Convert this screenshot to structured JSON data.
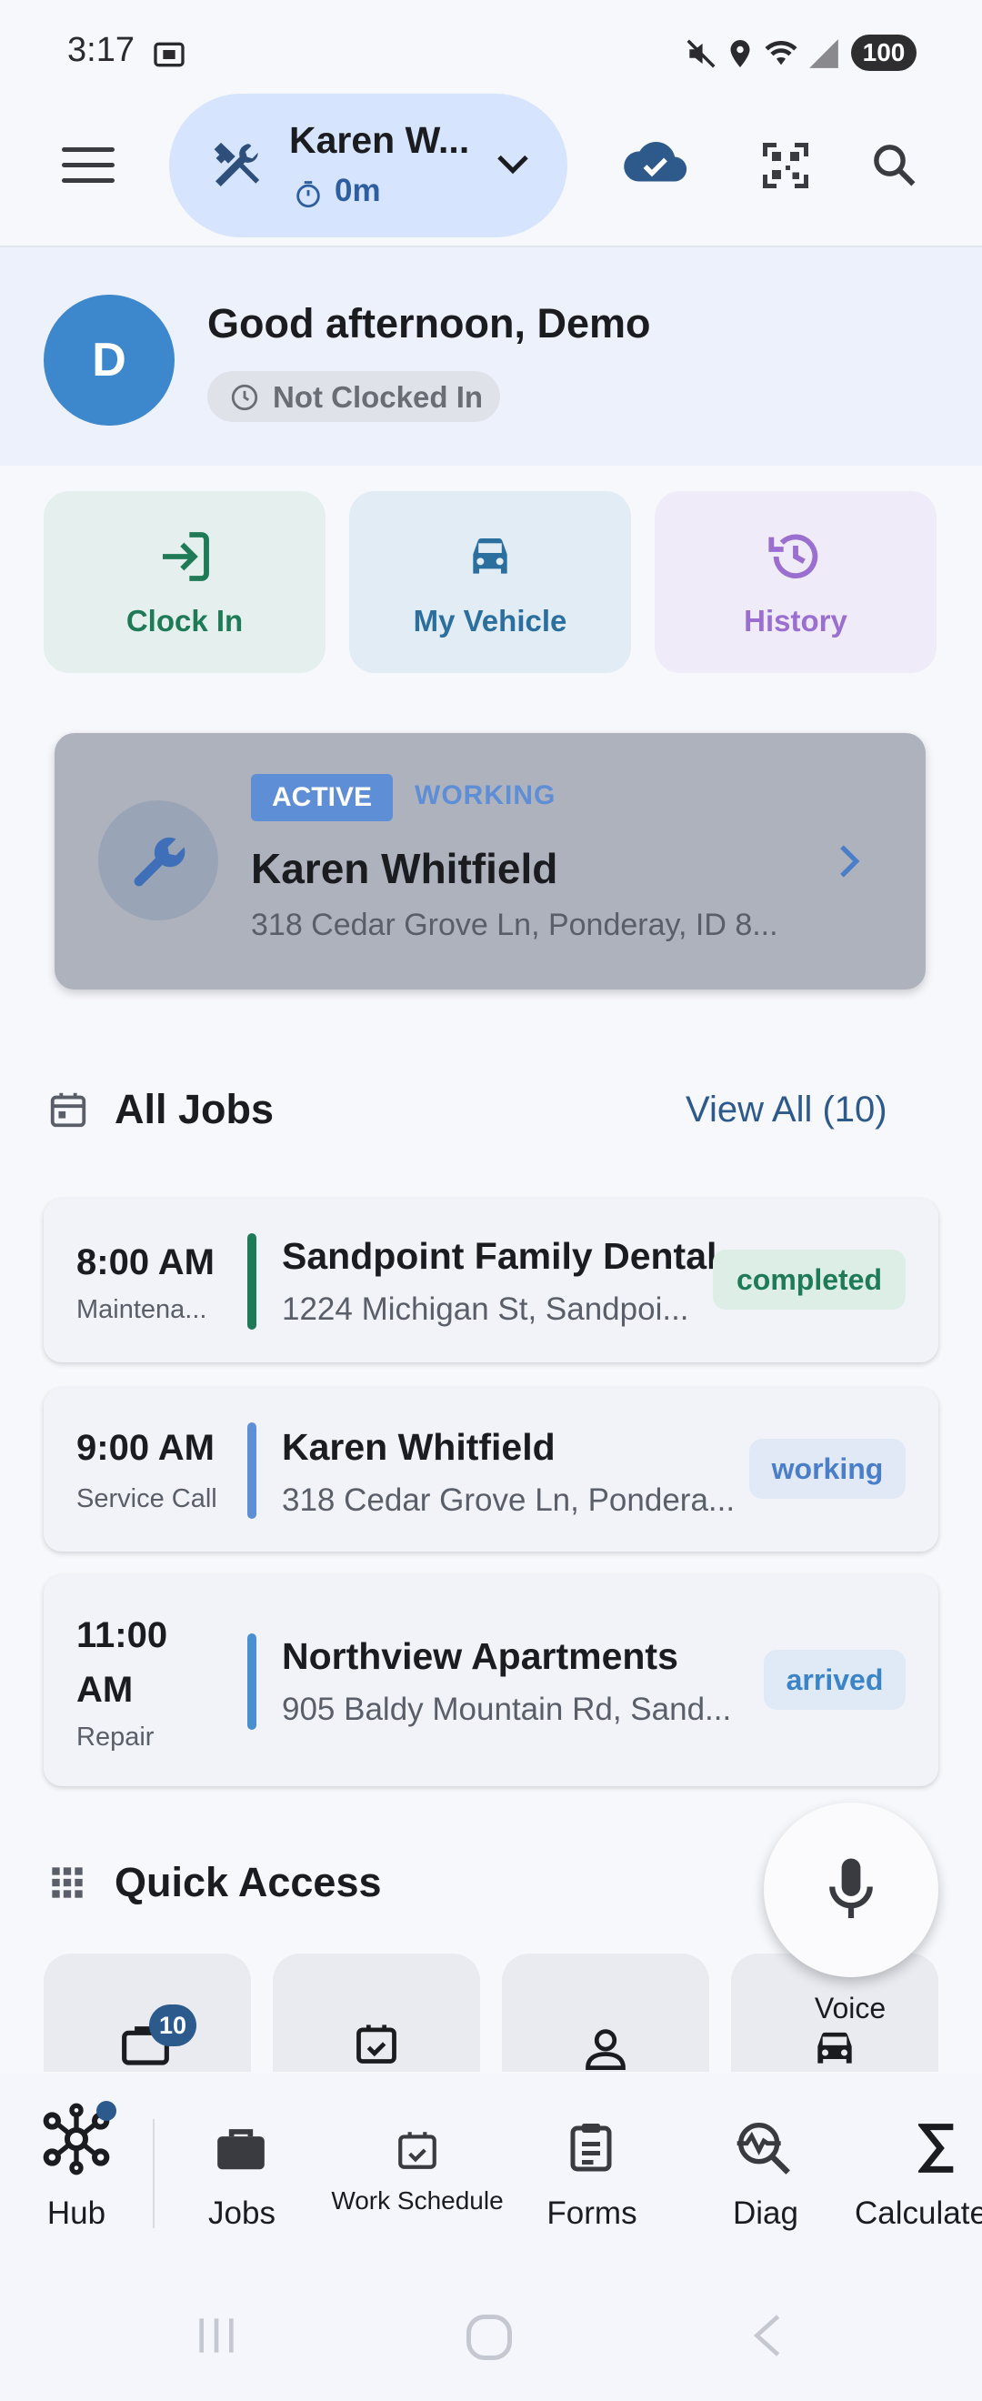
{
  "status_bar": {
    "time": "3:17",
    "battery": "100"
  },
  "app_bar": {
    "technician_name": "Karen W...",
    "timer": "0m",
    "icons": [
      "menu-icon",
      "tools-icon",
      "chevron-down-icon",
      "cloud-check-icon",
      "qr-code-icon",
      "search-icon"
    ]
  },
  "greeting": {
    "avatar_initial": "D",
    "message": "Good afternoon, Demo",
    "clock_status": "Not Clocked In"
  },
  "actions": [
    {
      "label": "Clock In",
      "color": "#1f7a57",
      "bg": "#e5f0ee"
    },
    {
      "label": "My Vehicle",
      "color": "#2a6f9e",
      "bg": "#e2ecf4"
    },
    {
      "label": "History",
      "color": "#9a6fd0",
      "bg": "#efebf8"
    }
  ],
  "active_job": {
    "badge": "ACTIVE",
    "status": "WORKING",
    "name": "Karen Whitfield",
    "address": "318 Cedar Grove Ln, Ponderay, ID 8..."
  },
  "jobs_section": {
    "title": "All Jobs",
    "view_all": "View All (10)",
    "jobs": [
      {
        "time": "8:00 AM",
        "type": "Maintena...",
        "name": "Sandpoint Family Dental",
        "address": "1224 Michigan St, Sandpoi...",
        "status": "completed",
        "bar_color": "#1f7a57",
        "status_color": "#1f7a57",
        "status_bg": "#dceee6"
      },
      {
        "time": "9:00 AM",
        "type": "Service Call",
        "name": "Karen Whitfield",
        "address": "318 Cedar Grove Ln, Pondera...",
        "status": "working",
        "bar_color": "#5e8ed6",
        "status_color": "#4a7ec9",
        "status_bg": "#e1e9f7"
      },
      {
        "time": "11:00",
        "time2": "AM",
        "type": "Repair",
        "name": "Northview Apartments",
        "address": "905 Baldy Mountain Rd, Sand...",
        "status": "arrived",
        "bar_color": "#4a90d0",
        "status_color": "#3c84c8",
        "status_bg": "#dfeaf6"
      }
    ]
  },
  "quick_access": {
    "title": "Quick Access",
    "badge": "10",
    "voice_label": "Voice"
  },
  "bottom_nav": {
    "items": [
      {
        "label": "Hub"
      },
      {
        "label": "Jobs"
      },
      {
        "label": "Work Schedule"
      },
      {
        "label": "Forms"
      },
      {
        "label": "Diag"
      },
      {
        "label": "Calculate"
      }
    ]
  }
}
